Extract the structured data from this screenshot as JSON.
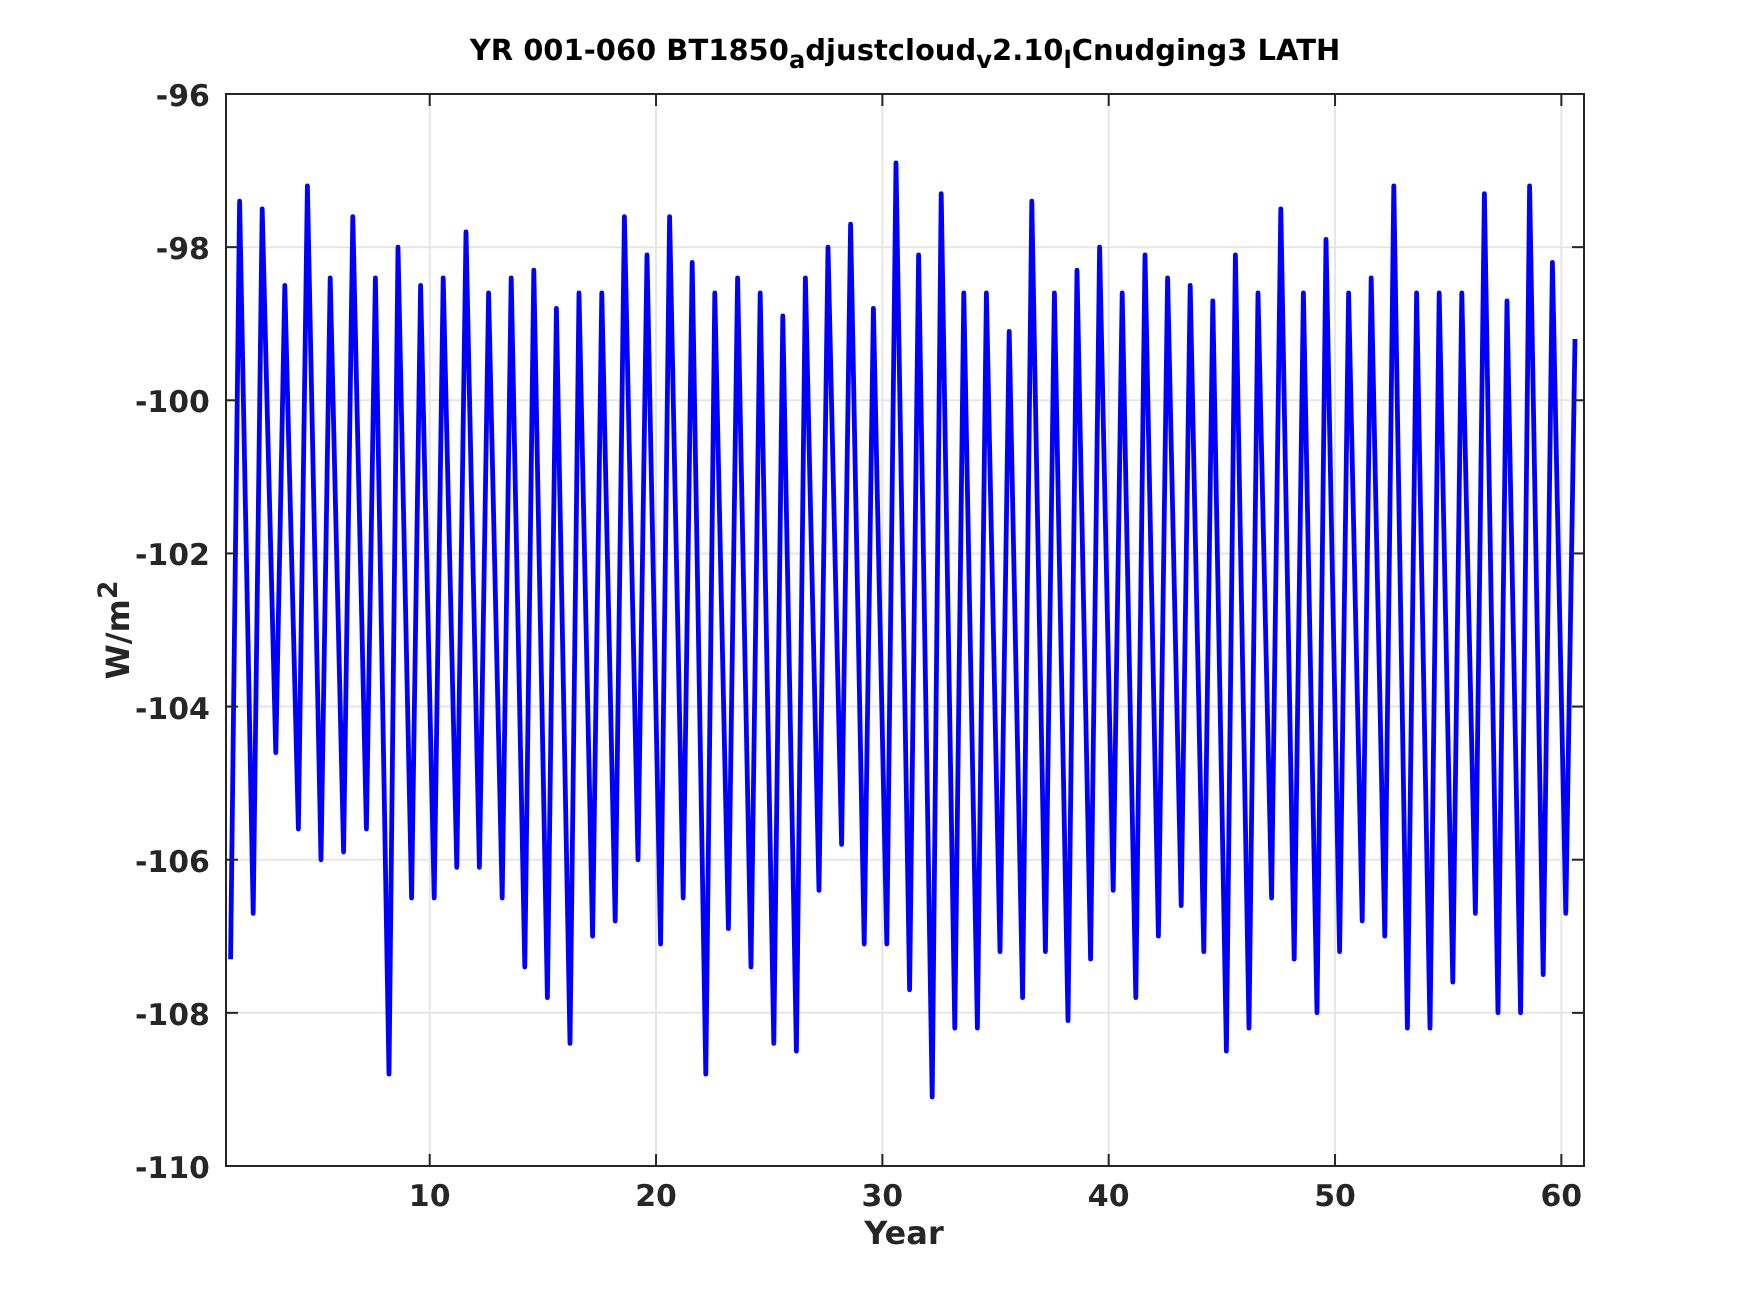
{
  "figure": {
    "chart_data": {
      "type": "line",
      "title": "YR 001-060 BT1850$_{a}$djustcloud$_{v}$2.10$_{l}$Cnudging3 LATH",
      "xlabel": "Year",
      "ylabel": "W/m$^{2}$",
      "xlim": [
        1,
        61
      ],
      "ylim": [
        -110,
        -96
      ],
      "grid": true,
      "xticks": [
        10,
        20,
        30,
        40,
        50,
        60
      ],
      "yticks": [
        -110,
        -108,
        -106,
        -104,
        -102,
        -100,
        -98,
        -96
      ],
      "x": [
        1.2,
        1.6,
        2.2,
        2.6,
        3.2,
        3.6,
        4.2,
        4.6,
        5.2,
        5.6,
        6.2,
        6.6,
        7.2,
        7.6,
        8.2,
        8.6,
        9.2,
        9.6,
        10.2,
        10.6,
        11.2,
        11.6,
        12.2,
        12.6,
        13.2,
        13.6,
        14.2,
        14.6,
        15.2,
        15.6,
        16.2,
        16.6,
        17.2,
        17.6,
        18.2,
        18.6,
        19.2,
        19.6,
        20.2,
        20.6,
        21.2,
        21.6,
        22.2,
        22.6,
        23.2,
        23.6,
        24.2,
        24.6,
        25.2,
        25.6,
        26.2,
        26.6,
        27.2,
        27.6,
        28.2,
        28.6,
        29.2,
        29.6,
        30.2,
        30.6,
        31.2,
        31.6,
        32.2,
        32.6,
        33.2,
        33.6,
        34.2,
        34.6,
        35.2,
        35.6,
        36.2,
        36.6,
        37.2,
        37.6,
        38.2,
        38.6,
        39.2,
        39.6,
        40.2,
        40.6,
        41.2,
        41.6,
        42.2,
        42.6,
        43.2,
        43.6,
        44.2,
        44.6,
        45.2,
        45.6,
        46.2,
        46.6,
        47.2,
        47.6,
        48.2,
        48.6,
        49.2,
        49.6,
        50.2,
        50.6,
        51.2,
        51.6,
        52.2,
        52.6,
        53.2,
        53.6,
        54.2,
        54.6,
        55.2,
        55.6,
        56.2,
        56.6,
        57.2,
        57.6,
        58.2,
        58.6,
        59.2,
        59.6,
        60.2,
        60.6
      ],
      "series": [
        {
          "color": "#0000ff",
          "values": [
            -107.3,
            -97.4,
            -106.7,
            -97.5,
            -104.6,
            -98.5,
            -105.6,
            -97.2,
            -106.0,
            -98.4,
            -105.9,
            -97.6,
            -105.6,
            -98.4,
            -108.8,
            -98.0,
            -106.5,
            -98.5,
            -106.5,
            -98.4,
            -106.1,
            -97.8,
            -106.1,
            -98.6,
            -106.5,
            -98.4,
            -107.4,
            -98.3,
            -107.8,
            -98.8,
            -108.4,
            -98.6,
            -107.0,
            -98.6,
            -106.8,
            -97.6,
            -106.0,
            -98.1,
            -107.1,
            -97.6,
            -106.5,
            -98.2,
            -108.8,
            -98.6,
            -106.9,
            -98.4,
            -107.4,
            -98.6,
            -108.4,
            -98.9,
            -108.5,
            -98.4,
            -106.4,
            -98.0,
            -105.8,
            -97.7,
            -107.1,
            -98.8,
            -107.1,
            -96.9,
            -107.7,
            -98.1,
            -109.1,
            -97.3,
            -108.2,
            -98.6,
            -108.2,
            -98.6,
            -107.2,
            -99.1,
            -107.8,
            -97.4,
            -107.2,
            -98.6,
            -108.1,
            -98.3,
            -107.3,
            -98.0,
            -106.4,
            -98.6,
            -107.8,
            -98.1,
            -107.0,
            -98.4,
            -106.6,
            -98.5,
            -107.2,
            -98.7,
            -108.5,
            -98.1,
            -108.2,
            -98.6,
            -106.5,
            -97.5,
            -107.3,
            -98.6,
            -108.0,
            -97.9,
            -107.2,
            -98.6,
            -106.8,
            -98.4,
            -107.0,
            -97.2,
            -108.2,
            -98.6,
            -108.2,
            -98.6,
            -107.6,
            -98.6,
            -106.7,
            -97.3,
            -108.0,
            -98.7,
            -108.0,
            -97.2,
            -107.5,
            -98.2,
            -106.7,
            -99.2
          ]
        }
      ]
    }
  }
}
